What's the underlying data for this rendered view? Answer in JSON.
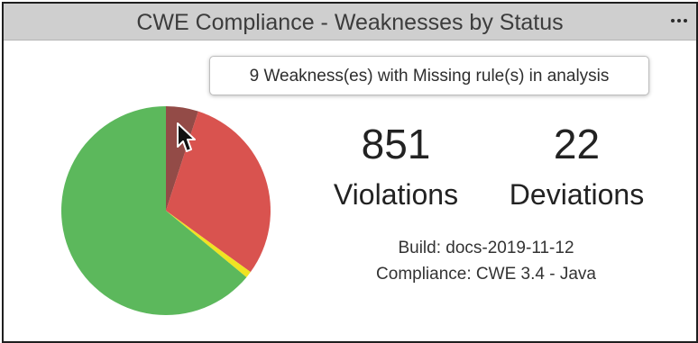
{
  "widget": {
    "title": "CWE Compliance - Weaknesses by Status",
    "menu_icon": "more-horizontal-icon"
  },
  "tooltip": {
    "text": "9 Weakness(es) with Missing rule(s) in analysis"
  },
  "stats": {
    "violations": {
      "value": "851",
      "label": "Violations"
    },
    "deviations": {
      "value": "22",
      "label": "Deviations"
    }
  },
  "info": {
    "build": "Build: docs-2019-11-12",
    "compliance": "Compliance: CWE 3.4 - Java"
  },
  "chart_data": {
    "type": "pie",
    "slices": [
      {
        "value": 0.05,
        "color": "#934b47"
      },
      {
        "value": 0.3,
        "color": "#d9534f"
      },
      {
        "value": 0.01,
        "color": "#f0e322"
      },
      {
        "value": 0.64,
        "color": "#5cb85c"
      }
    ]
  }
}
